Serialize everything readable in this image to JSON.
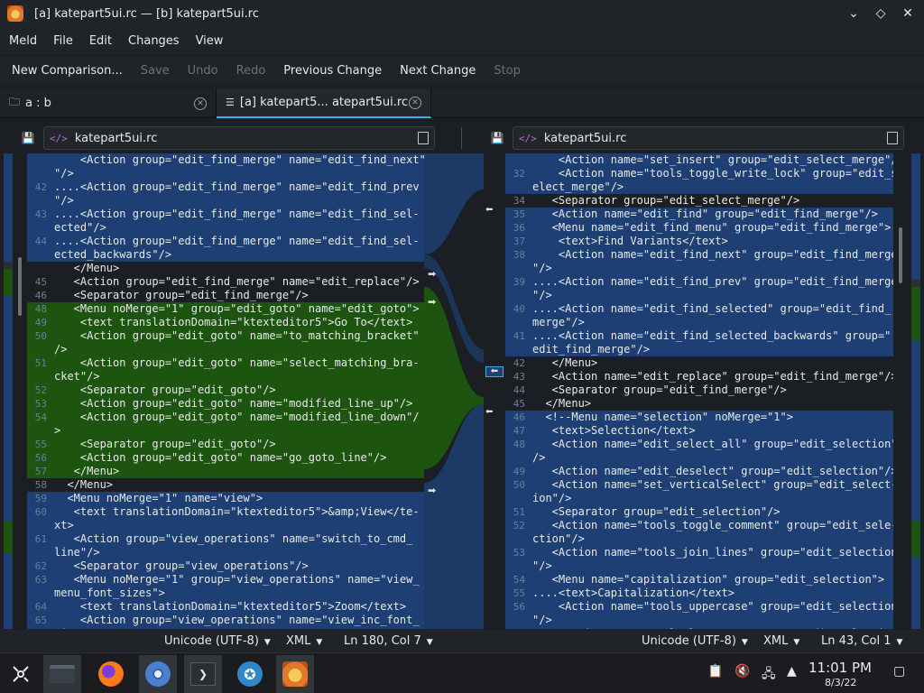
{
  "window": {
    "title": "[a] katepart5ui.rc — [b] katepart5ui.rc"
  },
  "menu": [
    "Meld",
    "File",
    "Edit",
    "Changes",
    "View"
  ],
  "toolbar": [
    {
      "label": "New Comparison...",
      "enabled": true
    },
    {
      "label": "Save",
      "enabled": false
    },
    {
      "label": "Undo",
      "enabled": false
    },
    {
      "label": "Redo",
      "enabled": false
    },
    {
      "label": "Previous Change",
      "enabled": true
    },
    {
      "label": "Next Change",
      "enabled": true
    },
    {
      "label": "Stop",
      "enabled": false
    }
  ],
  "tabs": [
    {
      "label": "a : b",
      "icon": "folder-icon"
    },
    {
      "label": "[a] katepart5... atepart5ui.rc",
      "icon": "document-icon"
    }
  ],
  "left_file": {
    "name": "katepart5ui.rc"
  },
  "right_file": {
    "name": "katepart5ui.rc"
  },
  "left_lines": [
    {
      "n": "",
      "t": "    <Action group=\"edit_find_merge\" name=\"edit_find_next\"",
      "k": "b"
    },
    {
      "n": "",
      "t": "\"/>",
      "k": "b"
    },
    {
      "n": "42",
      "t": "....<Action group=\"edit_find_merge\" name=\"edit_find_prev",
      "k": "b"
    },
    {
      "n": "",
      "t": "\"/>",
      "k": "b"
    },
    {
      "n": "43",
      "t": "....<Action group=\"edit_find_merge\" name=\"edit_find_sel-",
      "k": "b"
    },
    {
      "n": "",
      "t": "ected\"/>",
      "k": "b"
    },
    {
      "n": "44",
      "t": "....<Action group=\"edit_find_merge\" name=\"edit_find_sel-",
      "k": "b"
    },
    {
      "n": "",
      "t": "ected_backwards\"/>",
      "k": "b"
    },
    {
      "n": "",
      "t": "   </Menu>",
      "k": "n"
    },
    {
      "n": "45",
      "t": "   <Action group=\"edit_find_merge\" name=\"edit_replace\"/>",
      "k": "n"
    },
    {
      "n": "46",
      "t": "   <Separator group=\"edit_find_merge\"/>",
      "k": "n"
    },
    {
      "n": "48",
      "t": "   <Menu noMerge=\"1\" group=\"edit_goto\" name=\"edit_goto\">",
      "k": "g"
    },
    {
      "n": "49",
      "t": "    <text translationDomain=\"ktexteditor5\">Go To</text>",
      "k": "g"
    },
    {
      "n": "50",
      "t": "    <Action group=\"edit_goto\" name=\"to_matching_bracket\"",
      "k": "g"
    },
    {
      "n": "",
      "t": "/>",
      "k": "g"
    },
    {
      "n": "51",
      "t": "    <Action group=\"edit_goto\" name=\"select_matching_bra-",
      "k": "g"
    },
    {
      "n": "",
      "t": "cket\"/>",
      "k": "g"
    },
    {
      "n": "52",
      "t": "    <Separator group=\"edit_goto\"/>",
      "k": "g"
    },
    {
      "n": "53",
      "t": "    <Action group=\"edit_goto\" name=\"modified_line_up\"/>",
      "k": "g"
    },
    {
      "n": "54",
      "t": "    <Action group=\"edit_goto\" name=\"modified_line_down\"/",
      "k": "g"
    },
    {
      "n": "",
      "t": ">",
      "k": "g"
    },
    {
      "n": "55",
      "t": "    <Separator group=\"edit_goto\"/>",
      "k": "g"
    },
    {
      "n": "56",
      "t": "    <Action group=\"edit_goto\" name=\"go_goto_line\"/>",
      "k": "g"
    },
    {
      "n": "57",
      "t": "   </Menu>",
      "k": "g"
    },
    {
      "n": "58",
      "t": "  </Menu>",
      "k": "n"
    },
    {
      "n": "59",
      "t": "  <Menu noMerge=\"1\" name=\"view\">",
      "k": "b"
    },
    {
      "n": "60",
      "t": "   <text translationDomain=\"ktexteditor5\">&amp;View</te-",
      "k": "b"
    },
    {
      "n": "",
      "t": "xt>",
      "k": "b"
    },
    {
      "n": "61",
      "t": "   <Action group=\"view_operations\" name=\"switch_to_cmd_",
      "k": "b"
    },
    {
      "n": "",
      "t": "line\"/>",
      "k": "b"
    },
    {
      "n": "62",
      "t": "   <Separator group=\"view_operations\"/>",
      "k": "b"
    },
    {
      "n": "63",
      "t": "   <Menu noMerge=\"1\" group=\"view_operations\" name=\"view_",
      "k": "b"
    },
    {
      "n": "",
      "t": "menu_font_sizes\">",
      "k": "b"
    },
    {
      "n": "64",
      "t": "    <text translationDomain=\"ktexteditor5\">Zoom</text>",
      "k": "b"
    },
    {
      "n": "65",
      "t": "    <Action group=\"view_operations\" name=\"view_inc_font_",
      "k": "b"
    },
    {
      "n": "",
      "t": "sizes\"/>",
      "k": "b"
    }
  ],
  "right_lines": [
    {
      "n": "",
      "t": "    <Action name=\"set_insert\" group=\"edit_select_merge\"/>",
      "k": "b"
    },
    {
      "n": "32",
      "t": "    <Action name=\"tools_toggle_write_lock\" group=\"edit_s-",
      "k": "b"
    },
    {
      "n": "",
      "t": "elect_merge\"/>",
      "k": "b"
    },
    {
      "n": "34",
      "t": "   <Separator group=\"edit_select_merge\"/>",
      "k": "n"
    },
    {
      "n": "35",
      "t": "   <Action name=\"edit_find\" group=\"edit_find_merge\"/>",
      "k": "b"
    },
    {
      "n": "36",
      "t": "   <Menu name=\"edit_find_menu\" group=\"edit_find_merge\">",
      "k": "b"
    },
    {
      "n": "37",
      "t": "    <text>Find Variants</text>",
      "k": "b"
    },
    {
      "n": "38",
      "t": "    <Action name=\"edit_find_next\" group=\"edit_find_merge",
      "k": "b"
    },
    {
      "n": "",
      "t": "\"/>",
      "k": "b"
    },
    {
      "n": "39",
      "t": "....<Action name=\"edit_find_prev\" group=\"edit_find_merge",
      "k": "b"
    },
    {
      "n": "",
      "t": "\"/>",
      "k": "b"
    },
    {
      "n": "40",
      "t": "....<Action name=\"edit_find_selected\" group=\"edit_find_",
      "k": "b"
    },
    {
      "n": "",
      "t": "merge\"/>",
      "k": "b"
    },
    {
      "n": "41",
      "t": "....<Action name=\"edit_find_selected_backwards\" group=\"",
      "k": "b"
    },
    {
      "n": "",
      "t": "edit_find_merge\"/>",
      "k": "b"
    },
    {
      "n": "42",
      "t": "   </Menu>",
      "k": "n"
    },
    {
      "n": "43",
      "t": "   <Action name=\"edit_replace\" group=\"edit_find_merge\"/>",
      "k": "n"
    },
    {
      "n": "44",
      "t": "   <Separator group=\"edit_find_merge\"/>",
      "k": "n"
    },
    {
      "n": "45",
      "t": "  </Menu>",
      "k": "n"
    },
    {
      "n": "46",
      "t": "  <!--Menu name=\"selection\" noMerge=\"1\">",
      "k": "b"
    },
    {
      "n": "47",
      "t": "   <text>Selection</text>",
      "k": "b"
    },
    {
      "n": "48",
      "t": "   <Action name=\"edit_select_all\" group=\"edit_selection\"",
      "k": "b"
    },
    {
      "n": "",
      "t": "/>",
      "k": "b"
    },
    {
      "n": "49",
      "t": "   <Action name=\"edit_deselect\" group=\"edit_selection\"/>",
      "k": "b"
    },
    {
      "n": "50",
      "t": "   <Action name=\"set_verticalSelect\" group=\"edit_select-",
      "k": "b"
    },
    {
      "n": "",
      "t": "ion\"/>",
      "k": "b"
    },
    {
      "n": "51",
      "t": "   <Separator group=\"edit_selection\"/>",
      "k": "b"
    },
    {
      "n": "52",
      "t": "   <Action name=\"tools_toggle_comment\" group=\"edit_sele-",
      "k": "b"
    },
    {
      "n": "",
      "t": "ction\"/>",
      "k": "b"
    },
    {
      "n": "53",
      "t": "   <Action name=\"tools_join_lines\" group=\"edit_selection",
      "k": "b"
    },
    {
      "n": "",
      "t": "\"/>",
      "k": "b"
    },
    {
      "n": "54",
      "t": "   <Menu name=\"capitalization\" group=\"edit_selection\">",
      "k": "b"
    },
    {
      "n": "55",
      "t": "....<text>Capitalization</text>",
      "k": "b"
    },
    {
      "n": "56",
      "t": "    <Action name=\"tools_uppercase\" group=\"edit_selection",
      "k": "b"
    },
    {
      "n": "",
      "t": "\"/>",
      "k": "b"
    },
    {
      "n": "57",
      "t": "    <Action name=\"tools_lowercase\" group=\"edit_selection",
      "k": "b"
    }
  ],
  "status_left": {
    "encoding": "Unicode (UTF-8)",
    "syntax": "XML",
    "position": "Ln 180, Col 7"
  },
  "status_right": {
    "encoding": "Unicode (UTF-8)",
    "syntax": "XML",
    "position": "Ln 43, Col 1"
  },
  "taskbar": {
    "apps": [
      "application-launcher-icon",
      "file-manager-icon",
      "firefox-icon",
      "chromium-icon",
      "terminal-icon",
      "system-settings-icon",
      "meld-icon"
    ],
    "time": "11:01 PM",
    "date": "8/3/22"
  },
  "colors": {
    "blue": "#1d3f73",
    "blue_line": "#234a86",
    "green": "#1d5410",
    "accent": "#3daee9"
  }
}
